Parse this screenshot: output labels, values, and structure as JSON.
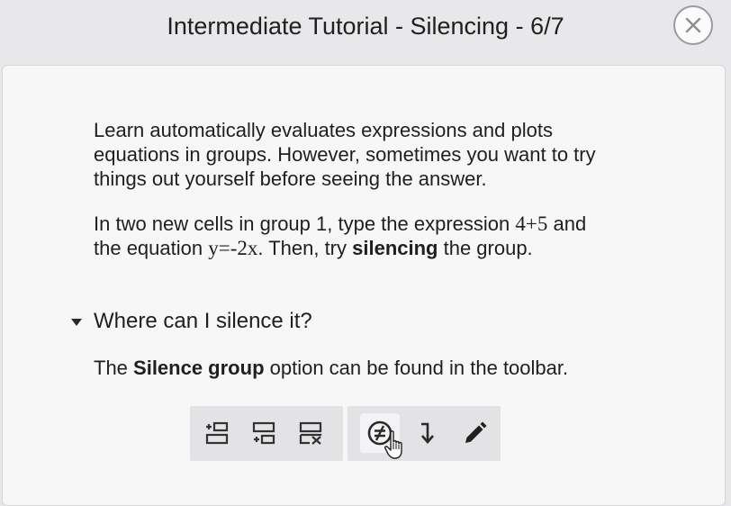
{
  "dialog": {
    "title": "Intermediate Tutorial - Silencing - 6/7",
    "close_icon": "close-icon"
  },
  "content": {
    "paragraph1": "Learn automatically evaluates expressions and plots equations in groups. However, sometimes you want to try things out yourself before seeing the answer.",
    "paragraph2": {
      "part1": "In two new cells in group 1, type the expression ",
      "expr": "4+5",
      "part2": " and the equation ",
      "equation": "y=-2x",
      "part3": ". Then, try ",
      "bold": "silencing",
      "part4": " the group."
    },
    "disclosure": {
      "label": "Where can I silence it?",
      "expanded": true,
      "icon": "caret-down-icon"
    },
    "paragraph3": {
      "part1": "The ",
      "bold": "Silence group",
      "part2": " option can be found in the toolbar."
    }
  },
  "toolbar": {
    "group1": [
      {
        "name": "insert-group-above-icon"
      },
      {
        "name": "insert-group-below-icon"
      },
      {
        "name": "delete-group-icon"
      }
    ],
    "group2": [
      {
        "name": "silence-group-icon",
        "active": true
      },
      {
        "name": "move-down-icon"
      },
      {
        "name": "edit-pencil-icon"
      }
    ]
  }
}
